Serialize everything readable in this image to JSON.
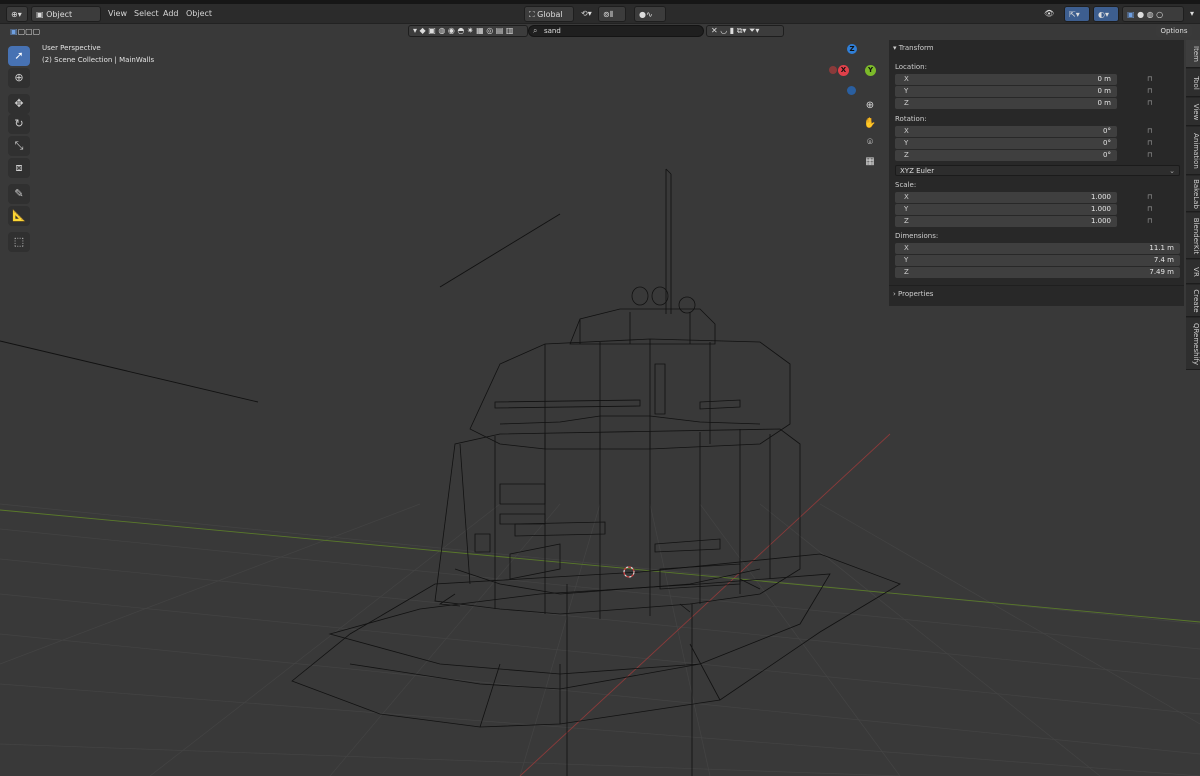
{
  "header": {
    "mode_label": "Object Mode",
    "menus": [
      "View",
      "Select",
      "Add",
      "Object"
    ],
    "orientation_label": "Global",
    "search_value": "sand",
    "options_label": "Options"
  },
  "viewport": {
    "title": "User Perspective",
    "subtitle": "(2) Scene Collection | MainWalls"
  },
  "gizmo": {
    "x": "X",
    "y": "Y",
    "z": "Z"
  },
  "toolbar": [
    "select-box",
    "cursor",
    "move",
    "rotate",
    "scale",
    "transform",
    "annotate",
    "measure",
    "add-cube"
  ],
  "npanel": {
    "section_title": "Transform",
    "location_label": "Location:",
    "location": [
      {
        "axis": "X",
        "value": "0 m"
      },
      {
        "axis": "Y",
        "value": "0 m"
      },
      {
        "axis": "Z",
        "value": "0 m"
      }
    ],
    "rotation_label": "Rotation:",
    "rotation": [
      {
        "axis": "X",
        "value": "0°"
      },
      {
        "axis": "Y",
        "value": "0°"
      },
      {
        "axis": "Z",
        "value": "0°"
      }
    ],
    "rotation_mode": "XYZ Euler",
    "scale_label": "Scale:",
    "scale": [
      {
        "axis": "X",
        "value": "1.000"
      },
      {
        "axis": "Y",
        "value": "1.000"
      },
      {
        "axis": "Z",
        "value": "1.000"
      }
    ],
    "dimensions_label": "Dimensions:",
    "dimensions": [
      {
        "axis": "X",
        "value": "11.1 m"
      },
      {
        "axis": "Y",
        "value": "7.4 m"
      },
      {
        "axis": "Z",
        "value": "7.49 m"
      }
    ],
    "properties_label": "Properties"
  },
  "side_tabs": [
    "Item",
    "Tool",
    "View",
    "Animation",
    "BakeLab",
    "BlenderKit",
    "VR",
    "Create",
    "QRemeshify"
  ],
  "colors": {
    "accent": "#4772b3",
    "x_axis": "#e0404a",
    "y_axis": "#7cba2a",
    "z_axis": "#2f7fd8"
  }
}
